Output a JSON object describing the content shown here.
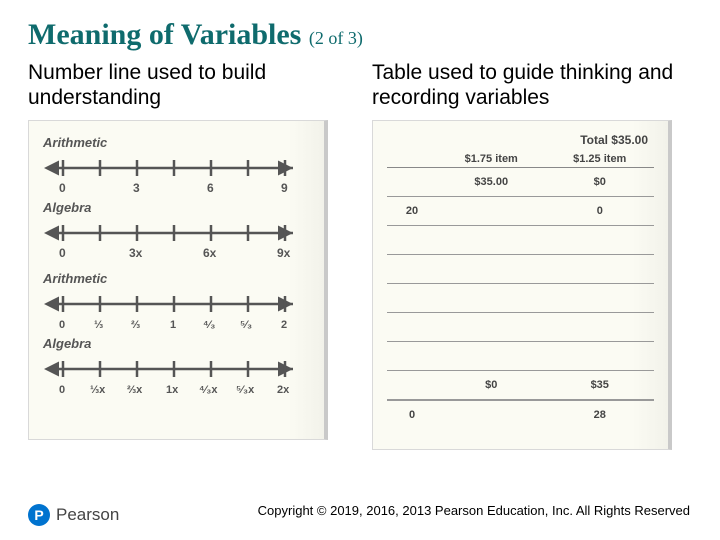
{
  "title": "Meaning of Variables",
  "title_sub": "(2 of 3)",
  "left_header": "Number line used to build understanding",
  "right_header": "Table used to guide thinking and recording variables",
  "numberlines": {
    "set1": {
      "arith_label": "Arithmetic",
      "alg_label": "Algebra",
      "arith_ticks": [
        "0",
        "3",
        "6",
        "9"
      ],
      "alg_ticks": [
        "0",
        "3x",
        "6x",
        "9x"
      ]
    },
    "set2": {
      "arith_label": "Arithmetic",
      "alg_label": "Algebra",
      "arith_ticks": [
        "0",
        "⅓",
        "⅔",
        "1",
        "⁴⁄₃",
        "⁵⁄₃",
        "2"
      ],
      "alg_ticks": [
        "0",
        "⅓x",
        "⅔x",
        "1x",
        "⁴⁄₃x",
        "⁵⁄₃x",
        "2x"
      ]
    }
  },
  "table": {
    "total_label": "Total $35.00",
    "col1_head": "$1.75 item",
    "col2_head": "$1.25 item",
    "row1": {
      "left": "20",
      "mid": "$35.00",
      "right": "0",
      "rightval": "$0"
    },
    "foot_pre": {
      "mid": "$0",
      "right": "$35"
    },
    "foot": {
      "left": "0",
      "right": "28"
    }
  },
  "copyright": "Copyright © 2019, 2016, 2013 Pearson Education, Inc. All Rights Reserved",
  "logo_text": "Pearson"
}
